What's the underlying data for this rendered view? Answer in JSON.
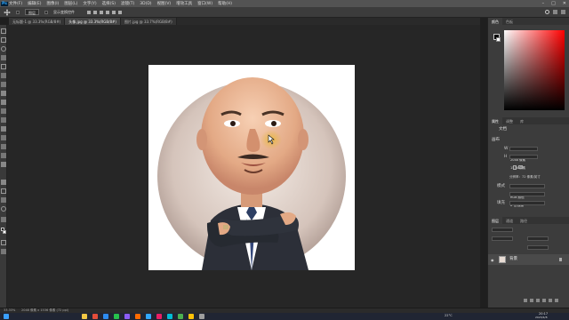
{
  "menubar": {
    "logo": "Ps",
    "items": [
      "文件(F)",
      "编辑(E)",
      "图像(I)",
      "图层(L)",
      "文字(Y)",
      "选择(S)",
      "滤镜(T)",
      "3D(D)",
      "视图(V)",
      "增效工具",
      "窗口(W)",
      "帮助(H)"
    ]
  },
  "options": {
    "select1": "图层",
    "check_label": "显示变换控件"
  },
  "tabs": [
    {
      "label": "无标题-1 @ 33.3%(RGB/8#)",
      "active": false
    },
    {
      "label": "头像.jpg @ 33.3%(RGB/8#)",
      "active": true
    },
    {
      "label": "图片.jpg @ 33.7%(RGB/8#)",
      "active": false
    }
  ],
  "right_panel": {
    "top_tabs": [
      "颜色",
      "色板"
    ],
    "props_tabs": [
      "属性",
      "调整",
      "库"
    ],
    "doc_label": "文档",
    "canvas_title": "画布",
    "w_label": "W",
    "w_value": "2048 像素",
    "h_label": "H",
    "h_value": "1536 像素",
    "resolution": "分辨率：72 像素/英寸",
    "mode_label": "模式",
    "mode_value": "RGB 颜色",
    "depth_value": "8 位/通道",
    "fill_label": "填充",
    "layers_tabs": [
      "图层",
      "通道",
      "路径"
    ],
    "layer_name": "背景"
  },
  "status": {
    "zoom": "33.33%",
    "doc_info": "2048 像素 x 1536 像素 (72 ppi)"
  },
  "taskbar": {
    "weather": "22°C",
    "time": "20:17",
    "date": "2023/4/8"
  },
  "colors": {
    "accent": "#31a8ff",
    "menubar": "#535353",
    "panel": "#3c3c3c",
    "canvas": "#262626"
  }
}
